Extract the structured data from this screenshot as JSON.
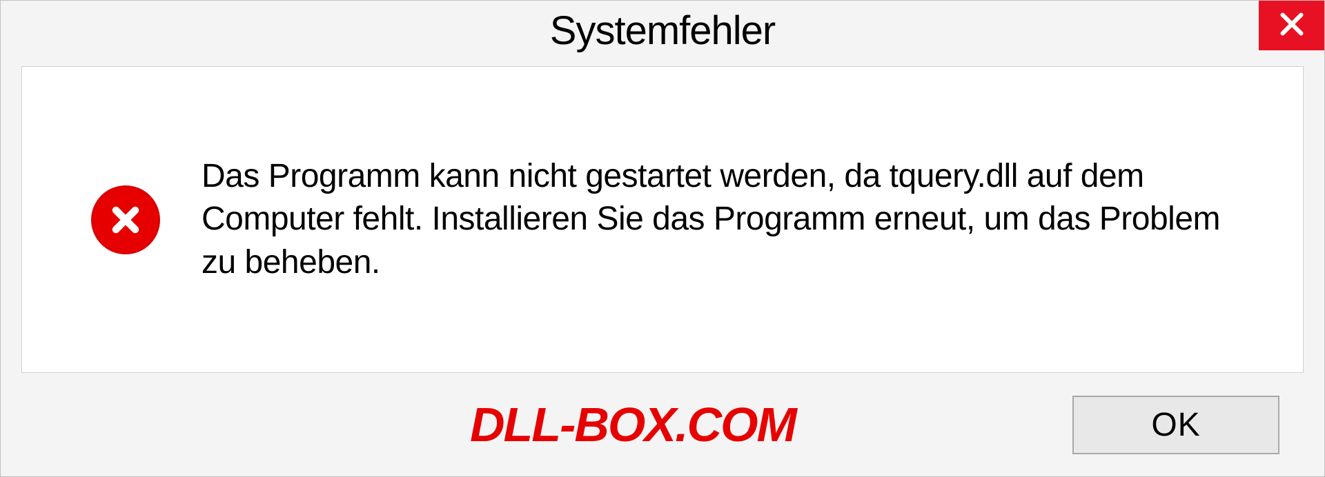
{
  "dialog": {
    "title": "Systemfehler",
    "message": "Das Programm kann nicht gestartet werden, da tquery.dll auf dem Computer fehlt. Installieren Sie das Programm erneut, um das Problem zu beheben.",
    "ok_label": "OK"
  },
  "watermark": "DLL-BOX.COM",
  "colors": {
    "error_red": "#e60000",
    "close_red": "#e81123"
  }
}
